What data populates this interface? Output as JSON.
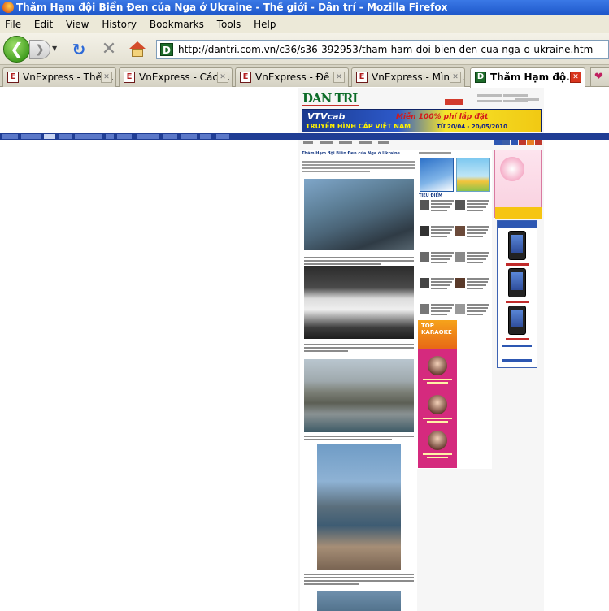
{
  "window": {
    "title": "Thăm Hạm đội Biển Đen của Nga ở Ukraine - Thế giới - Dân trí - Mozilla Firefox"
  },
  "menu": {
    "items": [
      "File",
      "Edit",
      "View",
      "History",
      "Bookmarks",
      "Tools",
      "Help"
    ]
  },
  "nav": {
    "back_icon": "back-arrow-icon",
    "forward_icon": "forward-arrow-icon",
    "reload_icon": "reload-icon",
    "stop_icon": "stop-icon",
    "home_icon": "home-icon",
    "url": "http://dantri.com.vn/c36/s36-392953/tham-ham-doi-bien-den-cua-nga-o-ukraine.htm"
  },
  "tabs": [
    {
      "label": "VnExpress - Thế ...",
      "favicon": "E",
      "active": false
    },
    {
      "label": "VnExpress - Các ...",
      "favicon": "E",
      "active": false
    },
    {
      "label": "VnExpress - Đề ...",
      "favicon": "E",
      "active": false
    },
    {
      "label": "VnExpress - Mìn l...",
      "favicon": "E",
      "active": false
    },
    {
      "label": "Thăm Hạm độ...",
      "favicon": "D",
      "active": true
    }
  ],
  "page": {
    "logo": "DAN TRI",
    "banner": {
      "line1": "VTVcab",
      "line2": "TRUYỀN HÌNH CÁP VIỆT NAM",
      "promo": "Miễn 100% phí lắp đặt",
      "dates": "TỪ 20/04 - 20/05/2010"
    },
    "article_title": "Thăm Hạm đội Biển Đen của Nga ở Ukraine",
    "sidebar_heading": "TIÊU ĐIỂM",
    "karaoke_label": "TOP KARAOKE"
  },
  "colors": {
    "titlebar": "#1d56c9",
    "site_green": "#0b6b27",
    "site_navy": "#1f3d94",
    "karaoke_pink": "#d52a7e"
  }
}
